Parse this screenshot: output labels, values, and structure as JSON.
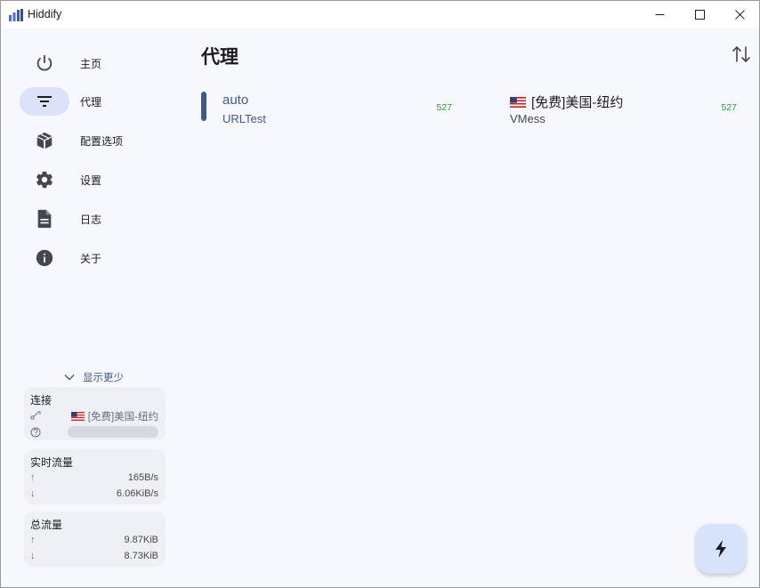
{
  "window": {
    "title": "Hiddify"
  },
  "sidebar": {
    "items": [
      {
        "label": "主页",
        "icon": "power-icon"
      },
      {
        "label": "代理",
        "icon": "filter-icon"
      },
      {
        "label": "配置选项",
        "icon": "package-icon"
      },
      {
        "label": "设置",
        "icon": "gear-icon"
      },
      {
        "label": "日志",
        "icon": "document-icon"
      },
      {
        "label": "关于",
        "icon": "info-icon"
      }
    ],
    "active_index": 1,
    "show_less_label": "显示更少"
  },
  "connection": {
    "title": "连接",
    "proxy_name": "[免费]美国-纽约"
  },
  "realtime": {
    "title": "实时流量",
    "upload": "165B/s",
    "download": "6.06KiB/s",
    "up_arrow": "↑",
    "down_arrow": "↓"
  },
  "total": {
    "title": "总流量",
    "upload": "9.87KiB",
    "download": "8.73KiB",
    "up_arrow": "↑",
    "down_arrow": "↓"
  },
  "main": {
    "title": "代理",
    "proxies": [
      {
        "name": "auto",
        "type": "URLTest",
        "delay": "527",
        "selected": true
      },
      {
        "name": "[免费]美国-纽约",
        "type": "VMess",
        "delay": "527",
        "selected": false
      }
    ]
  },
  "colors": {
    "accent": "#3f5a8a",
    "active_pill": "#dbe2f9",
    "delay_green": "#2ea043",
    "download_red": "#d93838",
    "fab_bg": "#d7e2fb"
  }
}
